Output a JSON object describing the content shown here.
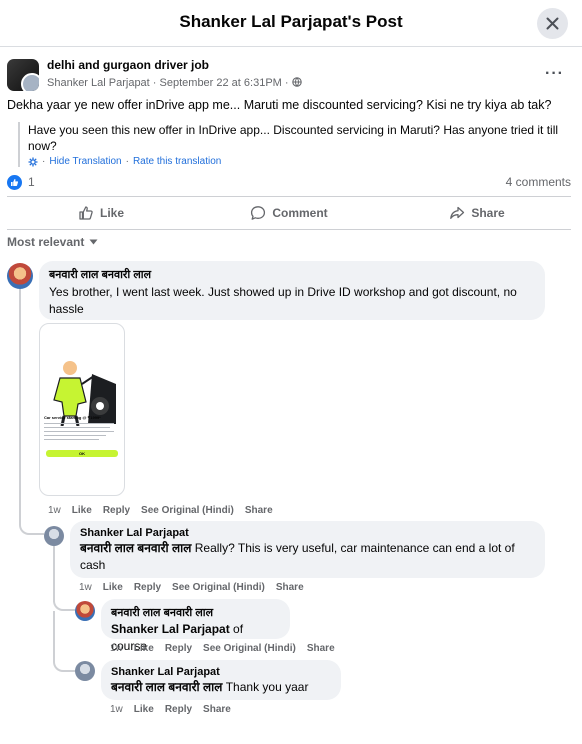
{
  "dialog": {
    "title": "Shanker Lal Parjapat's Post"
  },
  "post": {
    "group_name": "delhi and gurgaon driver job",
    "author": "Shanker Lal Parjapat",
    "date": "September 22 at 6:31PM",
    "meta_separator": "·",
    "privacy_icon": "globe-icon",
    "text": "Dekha yaar ye new offer inDrive app me... Maruti me discounted servicing? Kisi ne try kiya ab tak?",
    "translation": "Have you seen this new offer in InDrive app... Discounted servicing in Maruti? Has anyone tried it till now?",
    "hide_translation": "Hide Translation",
    "rate_translation": "Rate this translation",
    "reaction_count": "1",
    "comment_count": "4 comments",
    "more_label": "···"
  },
  "actions": {
    "like": "Like",
    "comment": "Comment",
    "share": "Share"
  },
  "sort": {
    "label": "Most relevant"
  },
  "comments": [
    {
      "author": "बनवारी लाल बनवारी लाल",
      "mention": "",
      "text": "Yes brother, I went last week. Just showed up in Drive ID workshop and got discount, no hassle",
      "time": "1w",
      "like": "Like",
      "reply": "Reply",
      "see_original": "See Original (Hindi)",
      "share": "Share"
    },
    {
      "author": "Shanker Lal Parjapat",
      "mention": "बनवारी लाल बनवारी लाल",
      "text": " Really? This is very useful, car maintenance can end a lot of cash",
      "time": "1w",
      "like": "Like",
      "reply": "Reply",
      "see_original": "See Original (Hindi)",
      "share": "Share"
    },
    {
      "author": "बनवारी लाल बनवारी लाल",
      "mention": "Shanker Lal Parjapat",
      "text": " of course",
      "time": "1w",
      "like": "Like",
      "reply": "Reply",
      "see_original": "See Original (Hindi)",
      "share": "Share"
    },
    {
      "author": "Shanker Lal Parjapat",
      "mention": "बनवारी लाल बनवारी लाल",
      "text": " Thank you yaar",
      "time": "1w",
      "like": "Like",
      "reply": "Reply",
      "share": "Share"
    }
  ],
  "attachment": {
    "headline": "Car service starting @ ₹1999*",
    "cta": "OK"
  },
  "colors": {
    "accent": "#1877f2",
    "link": "#216fdb",
    "bubble": "#f0f2f5",
    "muted": "#65676b",
    "ad_button": "#c6f432"
  }
}
